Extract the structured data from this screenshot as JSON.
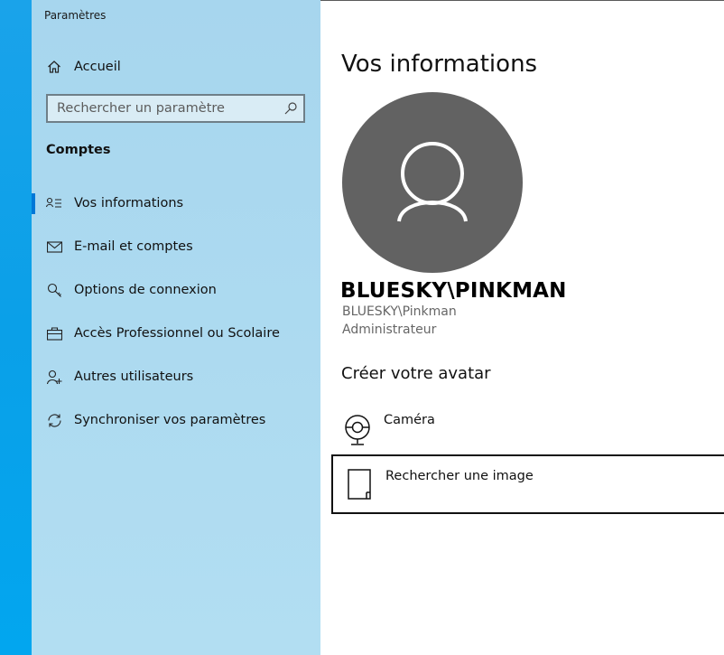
{
  "window": {
    "title": "Paramètres"
  },
  "sidebar": {
    "home_label": "Accueil",
    "search": {
      "placeholder": "Rechercher un paramètre"
    },
    "section_title": "Comptes",
    "items": [
      {
        "label": "Vos informations",
        "icon": "person-list-icon",
        "selected": true
      },
      {
        "label": "E-mail et comptes",
        "icon": "mail-icon"
      },
      {
        "label": "Options de connexion",
        "icon": "key-icon"
      },
      {
        "label": "Accès Professionnel ou Scolaire",
        "icon": "briefcase-icon"
      },
      {
        "label": "Autres utilisateurs",
        "icon": "add-person-icon"
      },
      {
        "label": "Synchroniser vos paramètres",
        "icon": "sync-icon"
      }
    ]
  },
  "main": {
    "title": "Vos informations",
    "account": {
      "display_name": "BLUESKY\\PINKMAN",
      "username": "BLUESKY\\Pinkman",
      "role": "Administrateur"
    },
    "create_avatar": {
      "heading": "Créer votre avatar",
      "actions": [
        {
          "label": "Caméra",
          "icon": "webcam-icon"
        },
        {
          "label": "Rechercher une image",
          "icon": "document-icon"
        }
      ]
    }
  },
  "colors": {
    "sidebar_bg": "#a9d8ef",
    "desktop_blue": "#0aa0e8",
    "accent": "#0078d7",
    "avatar_bg": "#626262"
  }
}
